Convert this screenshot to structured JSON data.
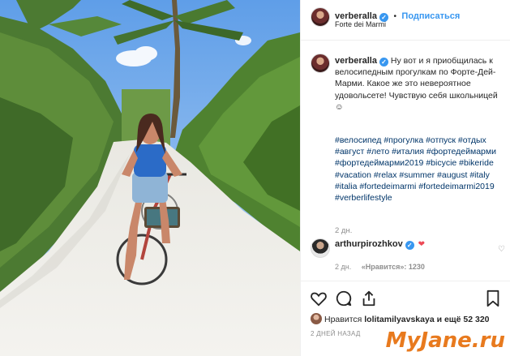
{
  "post": {
    "username": "verberalla",
    "follow_label": "Подписаться",
    "dot": "•",
    "location": "Forte dei Marmi",
    "caption_text": "Ну вот и я приобщилась к велосипедным прогулкам по Форте-Дей-Марми. Какое же это невероятное удовольсете! Чувствую себя школьницей ☺",
    "hashtags": "#велосипед #прогулка #отпуск #отдых #август #лето #италия #фортедеймарми #фортедеймарми2019 #bicycie #bikeride #vacation #relax #summer #august #italy #italia #fortedeimarmi #fortedeimarmi2019 #verberlifestyle",
    "caption_time": "2 дн."
  },
  "comment": {
    "username": "arthurpirozhkov",
    "heart": "❤",
    "time": "2 дн.",
    "likes": "«Нравится»: 1230"
  },
  "likes": {
    "prefix": "Нравится",
    "user": "lolitamilyavskaya",
    "suffix": "и ещё 52 320"
  },
  "post_date": "2 ДНЕЙ НАЗАД",
  "watermark": "MyJane.ru",
  "icons": [
    "verified-badge-icon",
    "heart-icon",
    "comment-icon",
    "share-icon",
    "bookmark-icon"
  ],
  "colors": {
    "link": "#003569",
    "accent": "#3897f0",
    "heart": "#ed4956"
  }
}
